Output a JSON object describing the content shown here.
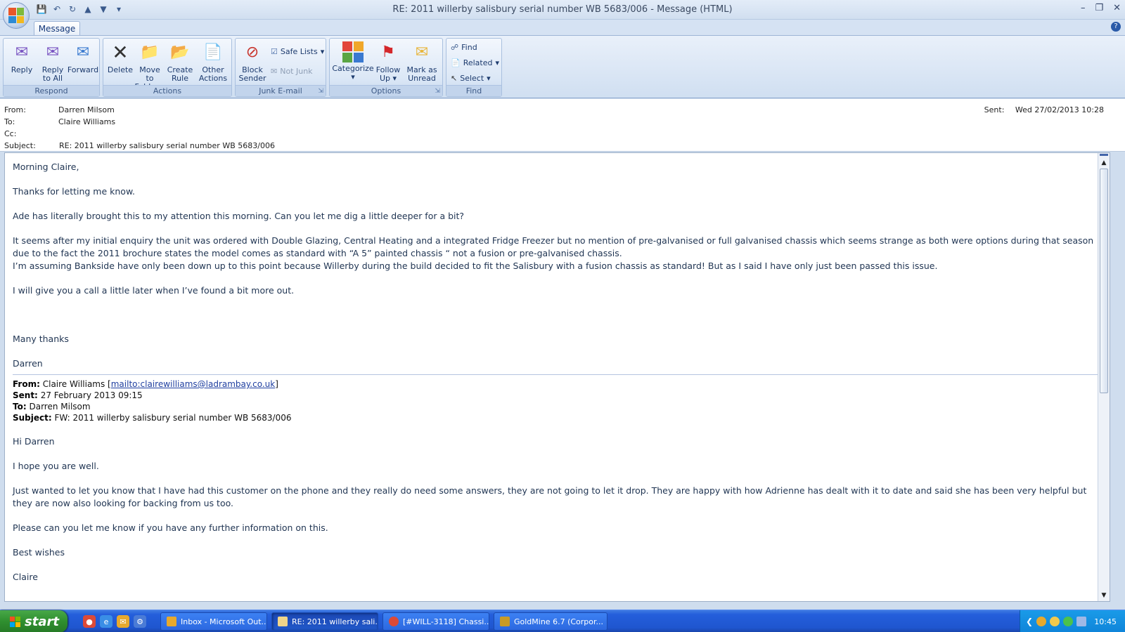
{
  "window": {
    "title": "RE: 2011 willerby salisbury serial number WB 5683/006 - Message (HTML)"
  },
  "ribbon": {
    "tab": "Message",
    "groups": {
      "respond": {
        "label": "Respond",
        "reply": "Reply",
        "reply_all_1": "Reply",
        "reply_all_2": "to All",
        "forward": "Forward"
      },
      "actions": {
        "label": "Actions",
        "delete": "Delete",
        "move_1": "Move to",
        "move_2": "Folder",
        "create_1": "Create",
        "create_2": "Rule",
        "other_1": "Other",
        "other_2": "Actions"
      },
      "junk": {
        "label": "Junk E-mail",
        "block_1": "Block",
        "block_2": "Sender",
        "safe_lists": "Safe Lists",
        "not_junk": "Not Junk"
      },
      "options": {
        "label": "Options",
        "categorize": "Categorize",
        "follow_1": "Follow",
        "follow_2": "Up",
        "mark_1": "Mark as",
        "mark_2": "Unread"
      },
      "find": {
        "label": "Find",
        "find": "Find",
        "related": "Related",
        "select": "Select"
      }
    }
  },
  "header": {
    "from_label": "From:",
    "from": "Darren Milsom",
    "to_label": "To:",
    "to": "Claire Williams",
    "cc_label": "Cc:",
    "cc": "",
    "subject_label": "Subject:",
    "subject": "RE: 2011 willerby salisbury serial number WB 5683/006",
    "sent_label": "Sent:",
    "sent": "Wed 27/02/2013 10:28"
  },
  "message": {
    "greeting": "Morning Claire,",
    "p1": "Thanks for letting me know.",
    "p2": "Ade has literally brought this to my attention this morning. Can you let me dig a little deeper for a bit?",
    "p3": "It seems after my initial enquiry the unit was ordered with Double Glazing, Central Heating and a integrated Fridge Freezer but no mention of pre-galvanised or full galvanised chassis which seems strange as both were options during that season due to the fact the 2011 brochure states the model comes as standard with “A 5” painted chassis “ not a fusion or pre-galvanised chassis.",
    "p4": "I’m assuming Bankside have only been down up to this point because Willerby during the build decided to fit the Salisbury with a fusion chassis as standard! But as I said I have only just been passed this issue.",
    "p5": "I will give you a call a little later when I’ve found a bit more out.",
    "closing": "Many thanks",
    "signature": "Darren"
  },
  "quoted": {
    "from_label": "From:",
    "from_name": "Claire Williams [",
    "from_link": "mailto:clairewilliams@ladrambay.co.uk",
    "from_end": "]",
    "sent_label": "Sent:",
    "sent": "27 February 2013 09:15",
    "to_label": "To:",
    "to": "Darren Milsom",
    "subject_label": "Subject:",
    "subject": "FW: 2011 willerby salisbury serial number WB 5683/006",
    "greeting": "Hi Darren",
    "p1": "I hope you are well.",
    "p2": "Just wanted to let you know that I have had this customer on the phone and they really do need some answers, they are not going to let it drop.  They are happy with how Adrienne has dealt with it to date and said she has been very helpful but they are now also looking for backing from us too.",
    "p3": "Please can you let me know if you have any further information on this.",
    "closing": "Best wishes",
    "signature": "Claire"
  },
  "taskbar": {
    "start": "start",
    "items": [
      "Inbox - Microsoft Out...",
      "RE: 2011 willerby sali...",
      "[#WILL-3118] Chassi...",
      "GoldMine 6.7 (Corpor..."
    ],
    "clock": "10:45"
  }
}
